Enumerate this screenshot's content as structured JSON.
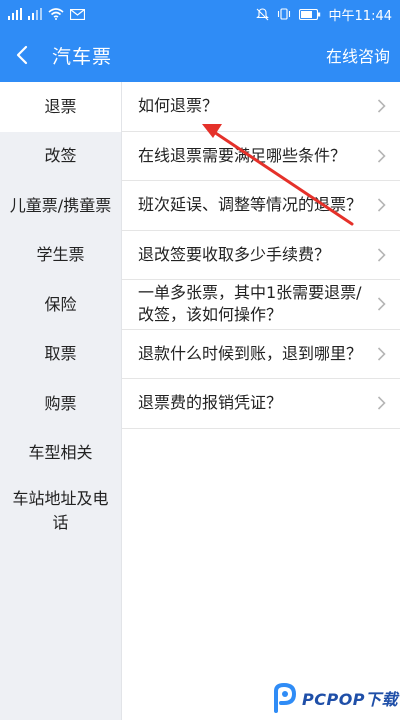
{
  "status_bar": {
    "time": "中午11:44"
  },
  "header": {
    "title": "汽车票",
    "consult": "在线咨询"
  },
  "sidebar": {
    "items": [
      {
        "label": "退票"
      },
      {
        "label": "改签"
      },
      {
        "label": "儿童票/携童票"
      },
      {
        "label": "学生票"
      },
      {
        "label": "保险"
      },
      {
        "label": "取票"
      },
      {
        "label": "购票"
      },
      {
        "label": "车型相关"
      },
      {
        "label": "车站地址及电话"
      }
    ]
  },
  "faq": {
    "items": [
      {
        "text": "如何退票？"
      },
      {
        "text": "在线退票需要满足哪些条件？"
      },
      {
        "text": "班次延误、调整等情况的退票？"
      },
      {
        "text": "退改签要收取多少手续费？"
      },
      {
        "text": "一单多张票，其中1张需要退票/改签，该如何操作？"
      },
      {
        "text": "退款什么时候到账，退到哪里？"
      },
      {
        "text": "退票费的报销凭证？"
      }
    ]
  },
  "watermark": {
    "text": "PCPOP下载"
  },
  "colors": {
    "primary": "#2f8cf6",
    "annotation": "#e5312a",
    "sidebar_bg": "#eef0f4"
  }
}
